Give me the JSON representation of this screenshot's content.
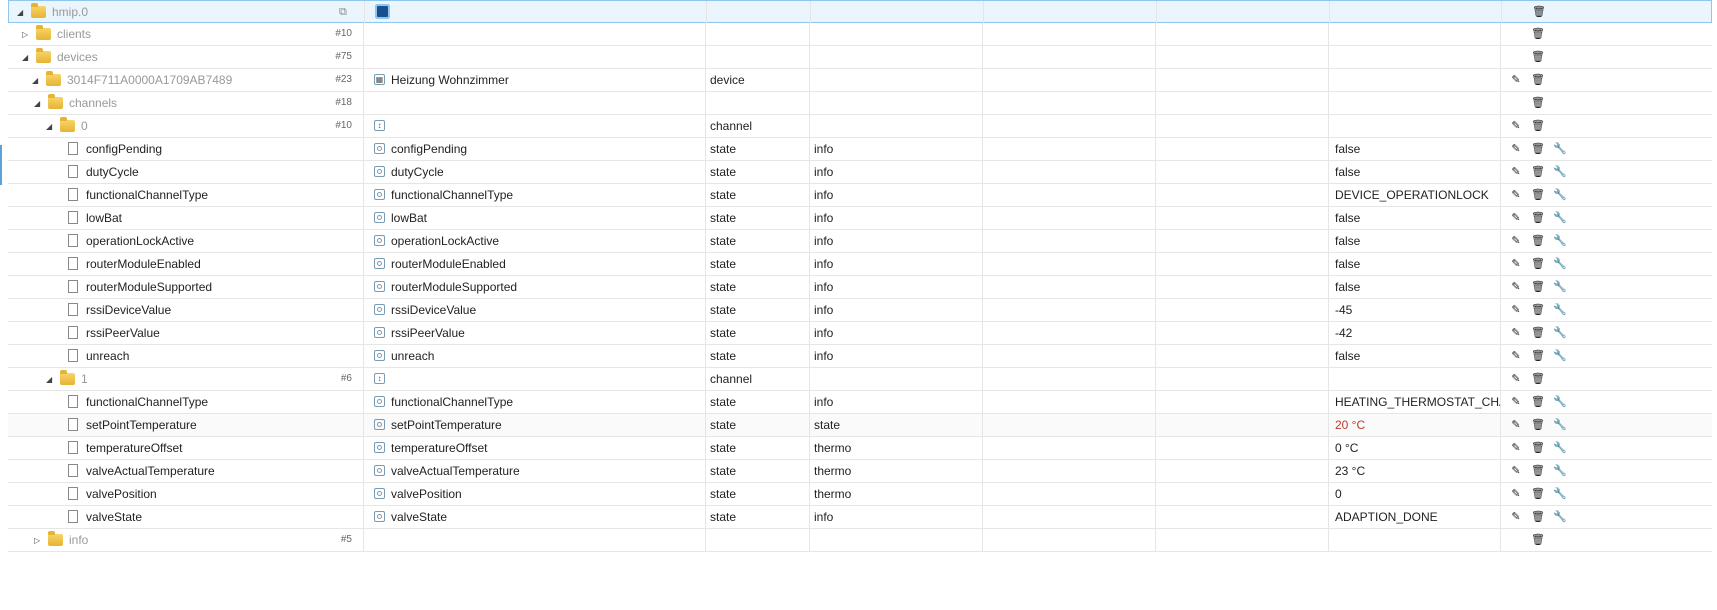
{
  "rows": [
    {
      "name": "hmip.0",
      "level": 0,
      "toggle": "◢",
      "icon": "folder",
      "muted": true,
      "id": "",
      "name2": "",
      "obj_icon": "adapter",
      "type": "",
      "role": "",
      "value": "",
      "actions": [
        "delete"
      ],
      "selected": true,
      "copy": "⧉"
    },
    {
      "name": "clients",
      "level": 1,
      "toggle": "▷",
      "icon": "folder",
      "muted": true,
      "id": "#10",
      "name2": "",
      "obj_icon": "",
      "type": "",
      "role": "",
      "value": "",
      "actions": [
        "delete"
      ]
    },
    {
      "name": "devices",
      "level": 1,
      "toggle": "◢",
      "icon": "folder",
      "muted": true,
      "id": "#75",
      "name2": "",
      "obj_icon": "",
      "type": "",
      "role": "",
      "value": "",
      "actions": [
        "delete"
      ]
    },
    {
      "name": "3014F711A0000A1709AB7489",
      "level": 2,
      "toggle": "◢",
      "icon": "folder",
      "muted": true,
      "id": "#23",
      "name2": "Heizung Wohnzimmer",
      "obj_icon": "device",
      "type": "device",
      "role": "",
      "value": "",
      "actions": [
        "edit",
        "delete"
      ]
    },
    {
      "name": "channels",
      "level": 3,
      "toggle": "◢",
      "icon": "folder",
      "muted": true,
      "id": "#18",
      "name2": "",
      "obj_icon": "",
      "type": "",
      "role": "",
      "value": "",
      "actions": [
        "delete"
      ]
    },
    {
      "name": "0",
      "level": 4,
      "toggle": "◢",
      "icon": "folder",
      "muted": true,
      "id": "#10",
      "name2": "",
      "obj_icon": "channel",
      "type": "channel",
      "role": "",
      "value": "",
      "actions": [
        "edit",
        "delete"
      ]
    },
    {
      "name": "configPending",
      "level": 5,
      "toggle": "",
      "icon": "file",
      "id": "",
      "name2": "configPending",
      "obj_icon": "state",
      "type": "state",
      "role": "info",
      "value": "false",
      "actions": [
        "edit",
        "delete",
        "wrench"
      ]
    },
    {
      "name": "dutyCycle",
      "level": 5,
      "toggle": "",
      "icon": "file",
      "id": "",
      "name2": "dutyCycle",
      "obj_icon": "state",
      "type": "state",
      "role": "info",
      "value": "false",
      "actions": [
        "edit",
        "delete",
        "wrench"
      ]
    },
    {
      "name": "functionalChannelType",
      "level": 5,
      "toggle": "",
      "icon": "file",
      "id": "",
      "name2": "functionalChannelType",
      "obj_icon": "state",
      "type": "state",
      "role": "info",
      "value": "DEVICE_OPERATIONLOCK",
      "actions": [
        "edit",
        "delete",
        "wrench"
      ]
    },
    {
      "name": "lowBat",
      "level": 5,
      "toggle": "",
      "icon": "file",
      "id": "",
      "name2": "lowBat",
      "obj_icon": "state",
      "type": "state",
      "role": "info",
      "value": "false",
      "actions": [
        "edit",
        "delete",
        "wrench"
      ]
    },
    {
      "name": "operationLockActive",
      "level": 5,
      "toggle": "",
      "icon": "file",
      "id": "",
      "name2": "operationLockActive",
      "obj_icon": "state",
      "type": "state",
      "role": "info",
      "value": "false",
      "actions": [
        "edit",
        "delete",
        "wrench"
      ]
    },
    {
      "name": "routerModuleEnabled",
      "level": 5,
      "toggle": "",
      "icon": "file",
      "id": "",
      "name2": "routerModuleEnabled",
      "obj_icon": "state",
      "type": "state",
      "role": "info",
      "value": "false",
      "actions": [
        "edit",
        "delete",
        "wrench"
      ]
    },
    {
      "name": "routerModuleSupported",
      "level": 5,
      "toggle": "",
      "icon": "file",
      "id": "",
      "name2": "routerModuleSupported",
      "obj_icon": "state",
      "type": "state",
      "role": "info",
      "value": "false",
      "actions": [
        "edit",
        "delete",
        "wrench"
      ]
    },
    {
      "name": "rssiDeviceValue",
      "level": 5,
      "toggle": "",
      "icon": "file",
      "id": "",
      "name2": "rssiDeviceValue",
      "obj_icon": "state",
      "type": "state",
      "role": "info",
      "value": "-45",
      "actions": [
        "edit",
        "delete",
        "wrench"
      ]
    },
    {
      "name": "rssiPeerValue",
      "level": 5,
      "toggle": "",
      "icon": "file",
      "id": "",
      "name2": "rssiPeerValue",
      "obj_icon": "state",
      "type": "state",
      "role": "info",
      "value": "-42",
      "actions": [
        "edit",
        "delete",
        "wrench"
      ]
    },
    {
      "name": "unreach",
      "level": 5,
      "toggle": "",
      "icon": "file",
      "id": "",
      "name2": "unreach",
      "obj_icon": "state",
      "type": "state",
      "role": "info",
      "value": "false",
      "actions": [
        "edit",
        "delete",
        "wrench"
      ]
    },
    {
      "name": "1",
      "level": 4,
      "toggle": "◢",
      "icon": "folder",
      "muted": true,
      "id": "#6",
      "name2": "",
      "obj_icon": "channel",
      "type": "channel",
      "role": "",
      "value": "",
      "actions": [
        "edit",
        "delete"
      ]
    },
    {
      "name": "functionalChannelType",
      "level": 5,
      "toggle": "",
      "icon": "file",
      "id": "",
      "name2": "functionalChannelType",
      "obj_icon": "state",
      "type": "state",
      "role": "info",
      "value": "HEATING_THERMOSTAT_CHANN",
      "actions": [
        "edit",
        "delete",
        "wrench"
      ]
    },
    {
      "name": "setPointTemperature",
      "level": 5,
      "toggle": "",
      "icon": "file",
      "id": "",
      "name2": "setPointTemperature",
      "obj_icon": "state",
      "type": "state",
      "role": "state",
      "value": "20 °C",
      "value_red": true,
      "actions": [
        "edit",
        "delete",
        "wrench"
      ],
      "hover": true
    },
    {
      "name": "temperatureOffset",
      "level": 5,
      "toggle": "",
      "icon": "file",
      "id": "",
      "name2": "temperatureOffset",
      "obj_icon": "state",
      "type": "state",
      "role": "thermo",
      "value": "0 °C",
      "actions": [
        "edit",
        "delete",
        "wrench"
      ]
    },
    {
      "name": "valveActualTemperature",
      "level": 5,
      "toggle": "",
      "icon": "file",
      "id": "",
      "name2": "valveActualTemperature",
      "obj_icon": "state",
      "type": "state",
      "role": "thermo",
      "value": "23 °C",
      "actions": [
        "edit",
        "delete",
        "wrench"
      ]
    },
    {
      "name": "valvePosition",
      "level": 5,
      "toggle": "",
      "icon": "file",
      "id": "",
      "name2": "valvePosition",
      "obj_icon": "state",
      "type": "state",
      "role": "thermo",
      "value": "0",
      "actions": [
        "edit",
        "delete",
        "wrench"
      ]
    },
    {
      "name": "valveState",
      "level": 5,
      "toggle": "",
      "icon": "file",
      "id": "",
      "name2": "valveState",
      "obj_icon": "state",
      "type": "state",
      "role": "info",
      "value": "ADAPTION_DONE",
      "actions": [
        "edit",
        "delete",
        "wrench"
      ]
    },
    {
      "name": "info",
      "level": 3,
      "toggle": "▷",
      "icon": "folder",
      "muted": true,
      "id": "#5",
      "name2": "",
      "obj_icon": "",
      "type": "",
      "role": "",
      "value": "",
      "actions": [
        "delete"
      ]
    }
  ]
}
